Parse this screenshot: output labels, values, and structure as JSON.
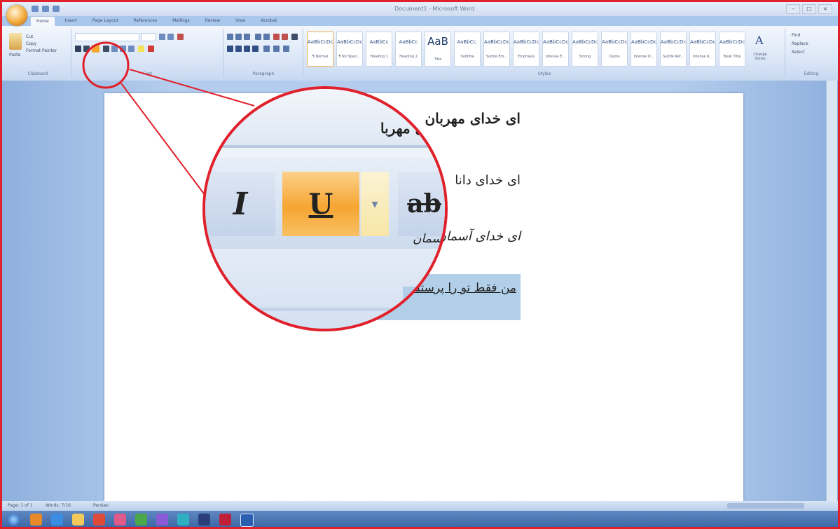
{
  "app": {
    "title": "Document1 - Microsoft Word",
    "window_controls": [
      "–",
      "□",
      "×"
    ]
  },
  "tabs": [
    "Home",
    "Insert",
    "Page Layout",
    "References",
    "Mailings",
    "Review",
    "View",
    "Acrobat"
  ],
  "ribbon": {
    "clipboard": {
      "paste": "Paste",
      "cut": "Cut",
      "copy": "Copy",
      "format_painter": "Format Painter",
      "label": "Clipboard"
    },
    "font": {
      "label": "Font"
    },
    "paragraph": {
      "label": "Paragraph"
    },
    "styles": {
      "label": "Styles",
      "items": [
        {
          "sample": "AaBbCcDc",
          "name": "¶ Normal"
        },
        {
          "sample": "AaBbCcDc",
          "name": "¶ No Spaci..."
        },
        {
          "sample": "AaBbCc",
          "name": "Heading 1"
        },
        {
          "sample": "AaBbCc",
          "name": "Heading 2"
        },
        {
          "sample": "AaB",
          "name": "Title"
        },
        {
          "sample": "AaBbCc.",
          "name": "Subtitle"
        },
        {
          "sample": "AaBbCcDc",
          "name": "Subtle Em..."
        },
        {
          "sample": "AaBbCcDc",
          "name": "Emphasis"
        },
        {
          "sample": "AaBbCcDc",
          "name": "Intense E..."
        },
        {
          "sample": "AaBbCcDc",
          "name": "Strong"
        },
        {
          "sample": "AaBbCcDc",
          "name": "Quote"
        },
        {
          "sample": "AaBbCcDc",
          "name": "Intense Q..."
        },
        {
          "sample": "AaBbCcDc",
          "name": "Subtle Ref..."
        },
        {
          "sample": "AaBbCcDc",
          "name": "Intense R..."
        },
        {
          "sample": "AaBbCcDc",
          "name": "Book Title"
        }
      ],
      "change_styles": "Change Styles"
    },
    "editing": {
      "find": "Find",
      "replace": "Replace",
      "select": "Select",
      "label": "Editing"
    }
  },
  "document": {
    "lines": [
      "ای خدای مهربان",
      "ای خدای دانا",
      "ای خدای آسمان",
      "من فقط تو را پرستش می کنم"
    ]
  },
  "status": {
    "page": "Page: 1 of 1",
    "words": "Words: 7/16",
    "language": "Persian"
  },
  "magnifier": {
    "italic": "I",
    "underline": "U",
    "dropdown": "▾",
    "strikethrough": "ab",
    "crop_line1": "ای خدای مهربا",
    "crop_line2": "ای خدای دا",
    "crop_line3": "ای خدای آسمان",
    "crop_line4": "من فقط تو را پرستش م"
  },
  "colors": {
    "callout": "#e0202a",
    "underline_active": "#f6a531",
    "selection": "#b2cfea"
  }
}
